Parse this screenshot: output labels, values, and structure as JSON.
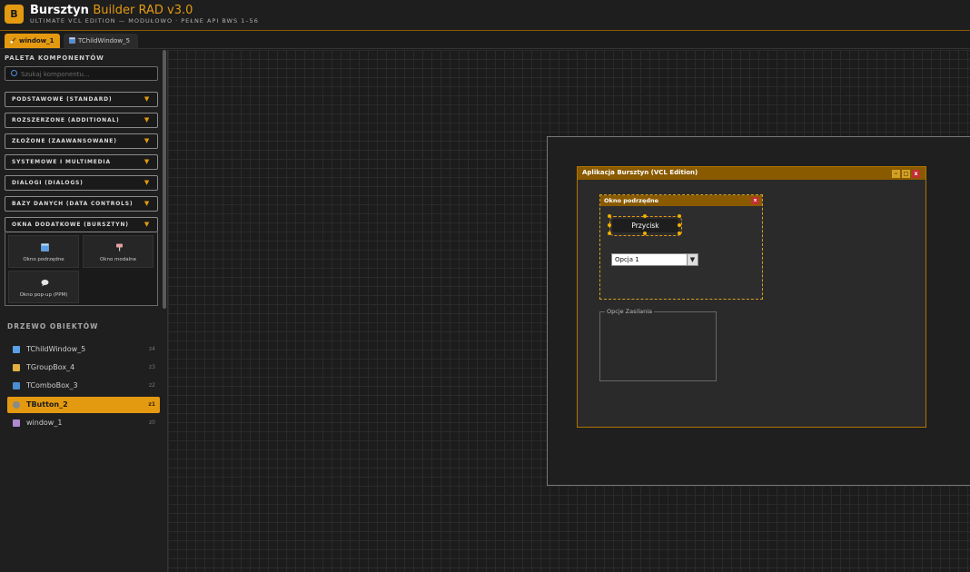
{
  "header": {
    "logo_letter": "B",
    "title_main": "Bursztyn",
    "title_accent": "Builder RAD v3.0",
    "subtitle": "ULTIMATE VCL EDITION — MODUŁOWO · PEŁNE API BWS 1–56"
  },
  "tabs": [
    {
      "label": "window_1",
      "active": true,
      "icon": "brush-icon"
    },
    {
      "label": "TChildWindow_5",
      "active": false,
      "icon": "window-icon"
    }
  ],
  "palette": {
    "title": "PALETA KOMPONENTÓW",
    "search_placeholder": "Szukaj komponentu...",
    "categories": [
      "PODSTAWOWE (STANDARD)",
      "ROZSZERZONE (ADDITIONAL)",
      "ZŁOŻONE (ZAAWANSOWANE)",
      "SYSTEMOWE I MULTIMEDIA",
      "DIALOGI (DIALOGS)",
      "BAZY DANYCH (DATA CONTROLS)",
      "OKNA DODATKOWE (BURSZTYN)"
    ],
    "expand_arrow": "▼",
    "components": [
      {
        "label": "Okno podrzędne",
        "icon": "child-window-icon"
      },
      {
        "label": "Okno modalne",
        "icon": "pin-icon"
      },
      {
        "label": "Okno pop-up (PPM)",
        "icon": "speech-bubble-icon"
      }
    ]
  },
  "tree": {
    "title": "DRZEWO OBIEKTÓW",
    "items": [
      {
        "label": "TChildWindow_5",
        "index": "z4",
        "selected": false,
        "icon": "child-window-icon"
      },
      {
        "label": "TGroupBox_4",
        "index": "z3",
        "selected": false,
        "icon": "groupbox-icon"
      },
      {
        "label": "TComboBox_3",
        "index": "z2",
        "selected": false,
        "icon": "combobox-icon"
      },
      {
        "label": "TButton_2",
        "index": "z1",
        "selected": true,
        "icon": "button-icon"
      },
      {
        "label": "window_1",
        "index": "z0",
        "selected": false,
        "icon": "window-icon"
      }
    ]
  },
  "designer": {
    "main_window_title": "Aplikacja Bursztyn (VCL Edition)",
    "min_glyph": "–",
    "max_glyph": "□",
    "close_glyph": "x",
    "child_window_title": "Okno podrzędne",
    "child_close_glyph": "x",
    "button_label": "Przycisk",
    "combo_value": "Opcja 1",
    "combo_arrow": "▼",
    "groupbox_caption": "Opcje Zasilania"
  },
  "colors": {
    "accent": "#e39a10",
    "titlebar": "#8a5a00",
    "close_red": "#c03030"
  }
}
